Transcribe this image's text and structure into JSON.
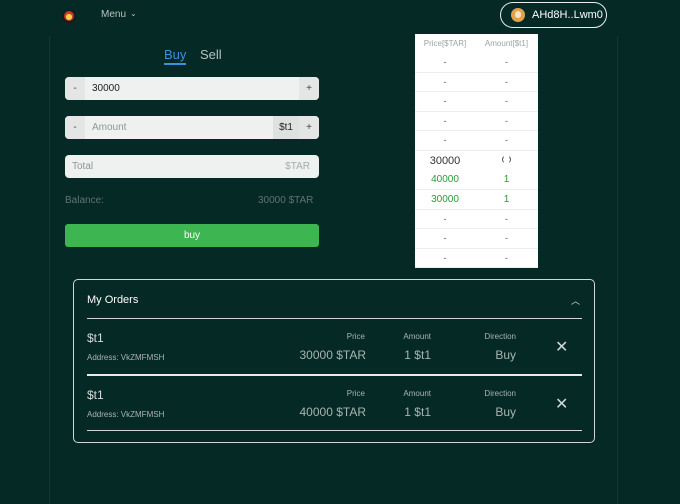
{
  "header": {
    "menu_label": "Menu",
    "wallet_label": "AHd8H..Lwm0"
  },
  "trade": {
    "tabs": [
      {
        "label": "Buy",
        "active": true
      },
      {
        "label": "Sell",
        "active": false
      }
    ],
    "price_field": {
      "minus": "-",
      "value": "30000",
      "plus": "+"
    },
    "amount_field": {
      "minus": "-",
      "placeholder": "Amount",
      "unit": "$t1",
      "plus": "+"
    },
    "total_field": {
      "placeholder": "Total",
      "unit": "$TAR"
    },
    "balance_label": "Balance:",
    "balance_value": "30000 $TAR",
    "buy_button": "buy"
  },
  "order_book": {
    "headers": [
      "Price[$TAR]",
      "Amount[$t1]"
    ],
    "asks": [
      [
        "-",
        "-"
      ],
      [
        "-",
        "-"
      ],
      [
        "-",
        "-"
      ],
      [
        "-",
        "-"
      ],
      [
        "-",
        "-"
      ]
    ],
    "mid_price": "30000",
    "bids": [
      [
        "40000",
        "1"
      ],
      [
        "30000",
        "1"
      ],
      [
        "-",
        "-"
      ],
      [
        "-",
        "-"
      ],
      [
        "-",
        "-"
      ]
    ]
  },
  "my_orders": {
    "title": "My Orders",
    "collapse_icon": "chevron-up-icon",
    "orders": [
      {
        "symbol": "$t1",
        "address": "Address: VkZMFMSH",
        "price_label": "Price",
        "price": "30000 $TAR",
        "amount_label": "Amount",
        "amount": "1 $t1",
        "direction_label": "Direction",
        "direction": "Buy"
      },
      {
        "symbol": "$t1",
        "address": "Address: VkZMFMSH",
        "price_label": "Price",
        "price": "40000 $TAR",
        "amount_label": "Amount",
        "amount": "1 $t1",
        "direction_label": "Direction",
        "direction": "Buy"
      }
    ]
  },
  "colors": {
    "background": "#052924",
    "accent_blue": "#3d8fe0",
    "buy_green": "#3db551",
    "bid_green": "#2d9a3a"
  }
}
